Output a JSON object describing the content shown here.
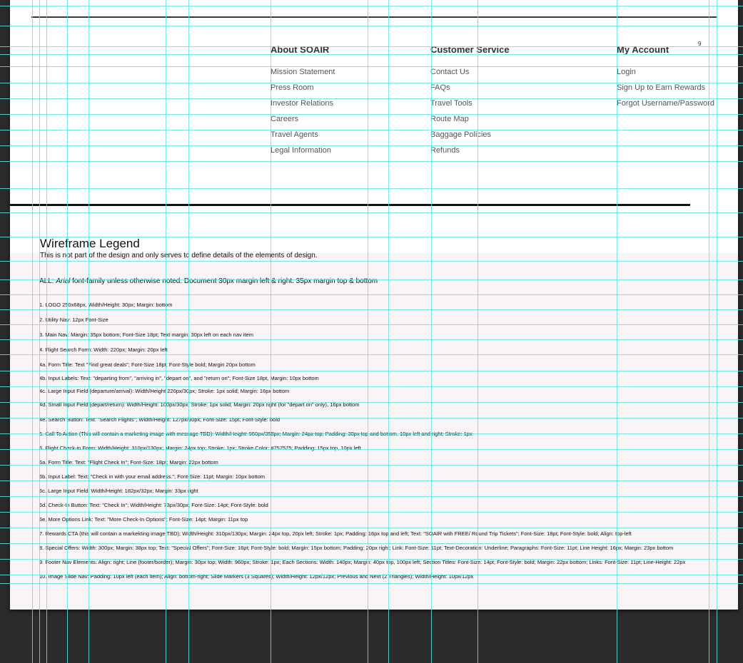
{
  "page_number": "9",
  "footer": {
    "columns": [
      {
        "title": "About SOAIR",
        "links": [
          "Mission Statement",
          "Press Room",
          "Investor Relations",
          "Careers",
          "Travel Agents",
          "Legal Information"
        ]
      },
      {
        "title": "Customer Service",
        "links": [
          "Contact Us",
          "FAQs",
          "Travel Tools",
          "Route Map",
          "Baggage Policies",
          "Refunds"
        ]
      },
      {
        "title": "My Account",
        "links": [
          "Login",
          "Sign Up to Earn Rewards",
          "Forgot Username/Password"
        ]
      }
    ]
  },
  "legend": {
    "title": "Wireframe Legend",
    "subtitle": "This is not part of the design and only serves to define details of the elements of design.",
    "all_prefix": "ALL: ",
    "all_font": "Arial",
    "all_rest": " font-family unless otherwise noted. Document 30px margin left & right. 35px margin top & bottom",
    "items": [
      "1. LOGO 250x68px, Width/Height: 30px; Margin: bottom",
      "2. Utility Nav: 12px Font-Size",
      "3. Main Nav: Margin: 35px bottom; Font-Size 18pt; Text margin: 30px left on each nav item",
      "4. Flight Search Form: Width: 220px; Margin: 20px left",
      "4a. Form Title: Text \"Find great deals\"; Font-Size 18pt; Font-Style bold; Margin 20px bottom",
      "4b. Input Labels: Text: \"departing from\", \"arriving in\", \"depart on\", and \"return on\"; Font-Size 18pt, Margin: 10px bottom",
      "4c. Large Input Field (departure/arrival): Width/Height 220px/30px; Stroke: 1px solid; Margin: 16px bottom",
      "4d. Small Input Field (depart/return): Width/Height: 100px/30px; Stroke: 1px solid; Margin: 20px right (for \"depart on\" only), 16px bottom",
      "4e. Search Button: Text: \"Search Flights\"; Width/Height: 127px/30px; Font-Size: 15pt; Font-Style: bold",
      "5. Call To Action (This will contain a marketing image with message TBD): Width/Height: 960px/358px; Margin: 24px top; Padding: 30px top and bottom, 10px left and right; Stroke: 1px",
      "6. Flight Check-in Form: Width/Height: 310px/130px; Margin: 24px top; Stroke: 1px; Stroke Color: #757575; Padding: 15px top, 10px left",
      "6a. Form Title: Text: \"Flight Check In\"; Font-Size: 18pt; Margin: 22px bottom",
      "6b. Input Label: Text: \"Check in with your email address.\"; Font-Size: 11pt; Margin: 10px bottom",
      "6c. Large Input Field: Width/Height: 182px/32px; Margin: 33px right",
      "6d. Check-In Button: Text: \"Check In\"; Width/Height: 73px/30px; Font-Size: 14pt; Font-Style: bold",
      "6e. More Options Link: Text: \"More Check-In Options\"; Font-Size: 14pt; Margin: 11px top",
      "7. Rewards CTA (this will contain a markekting image TBD); Width/Height: 310px/130px; Margin: 24px top, 20px left; Stroke: 1px; Padding: 16px top and left; Text: \"SOAIR with FREE/ Round Trip Tickets\"; Font-Size: 18pt; Font-Style: bold; Align: top-left",
      "8. Special Offers: Width: 300px; Margin: 38px top; Text: \"Special Offers\"; Font-Size: 16pt; Font-Style: bold; Margin: 15px bottom; Padding: 20px right; Link: Font-Size: 11pt; Text-Decoration: Underline; Paragraphs: Font-Size: 11pt; Line Height: 16px; Margin: 23px bottom",
      "9. Footer Nav Elements: Align: right; Line (footer/border); Margin: 30px top; Width: 960px; Stroke: 1px; Each Sections: Width: 140px; Margin: 40px top, 100px left; Section Titles: Font-Size: 14pt; Font-Style: bold; Margin: 22px bottom; Links: Font-Size: 11pt; Line-Height: 22px",
      "10. Image Slide Nav: Padding: 10px left (each item); Align: bottom-right; Slide Markers (3 Squares); Width/Height: 12px/12px; Previous and Next (2 Triangles); Width/Height: 10px/12px"
    ]
  },
  "colors": {
    "canvas": "#2b2b2b",
    "document": "#ffffff",
    "document_lower": "#f8f5f4",
    "guide": "#5fe3e3",
    "divider": "#111111"
  }
}
